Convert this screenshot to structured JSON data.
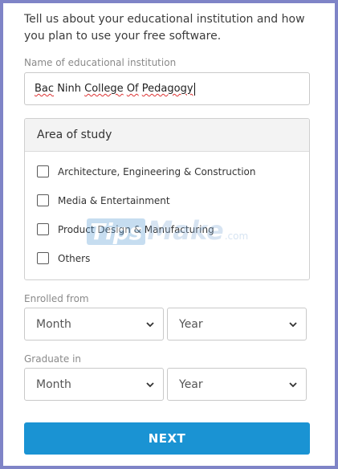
{
  "intro": {
    "line1": "Tell us about your educational institution and how",
    "line2": "you plan to use your free software."
  },
  "institution": {
    "label": "Name of educational institution",
    "value_words": [
      "Bac",
      "Ninh",
      "College",
      "Of",
      "Pedagogy"
    ]
  },
  "area_of_study": {
    "title": "Area of study",
    "options": [
      {
        "label": "Architecture, Engineering & Construction",
        "checked": false
      },
      {
        "label": "Media & Entertainment",
        "checked": false
      },
      {
        "label": "Product Design & Manufacturing",
        "checked": false
      },
      {
        "label": "Others",
        "checked": false
      }
    ]
  },
  "enrolled": {
    "label": "Enrolled from",
    "month": "Month",
    "year": "Year"
  },
  "graduate": {
    "label": "Graduate in",
    "month": "Month",
    "year": "Year"
  },
  "next_button": "NEXT",
  "watermark": {
    "logo": "Tips",
    "text": "Make",
    "suffix": ".com"
  },
  "colors": {
    "accent": "#1a93d3",
    "frame": "#7f84c7"
  }
}
